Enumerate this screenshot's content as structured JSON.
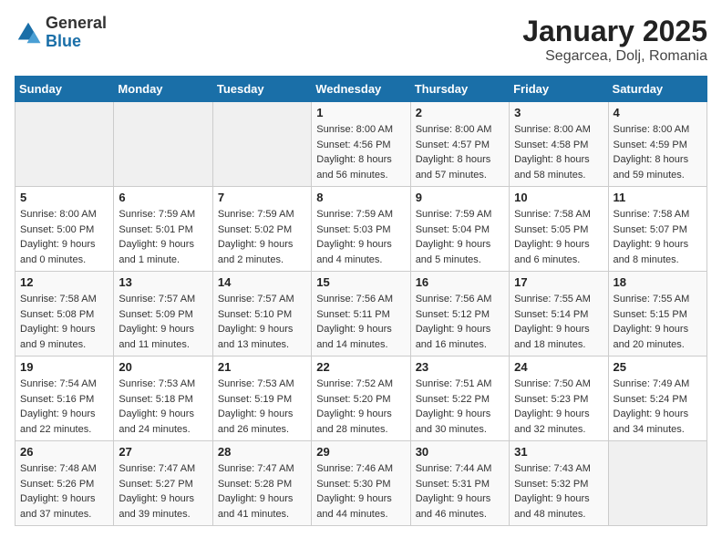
{
  "header": {
    "logo_general": "General",
    "logo_blue": "Blue",
    "title": "January 2025",
    "subtitle": "Segarcea, Dolj, Romania"
  },
  "calendar": {
    "weekdays": [
      "Sunday",
      "Monday",
      "Tuesday",
      "Wednesday",
      "Thursday",
      "Friday",
      "Saturday"
    ],
    "weeks": [
      [
        {
          "day": "",
          "info": ""
        },
        {
          "day": "",
          "info": ""
        },
        {
          "day": "",
          "info": ""
        },
        {
          "day": "1",
          "info": "Sunrise: 8:00 AM\nSunset: 4:56 PM\nDaylight: 8 hours\nand 56 minutes."
        },
        {
          "day": "2",
          "info": "Sunrise: 8:00 AM\nSunset: 4:57 PM\nDaylight: 8 hours\nand 57 minutes."
        },
        {
          "day": "3",
          "info": "Sunrise: 8:00 AM\nSunset: 4:58 PM\nDaylight: 8 hours\nand 58 minutes."
        },
        {
          "day": "4",
          "info": "Sunrise: 8:00 AM\nSunset: 4:59 PM\nDaylight: 8 hours\nand 59 minutes."
        }
      ],
      [
        {
          "day": "5",
          "info": "Sunrise: 8:00 AM\nSunset: 5:00 PM\nDaylight: 9 hours\nand 0 minutes."
        },
        {
          "day": "6",
          "info": "Sunrise: 7:59 AM\nSunset: 5:01 PM\nDaylight: 9 hours\nand 1 minute."
        },
        {
          "day": "7",
          "info": "Sunrise: 7:59 AM\nSunset: 5:02 PM\nDaylight: 9 hours\nand 2 minutes."
        },
        {
          "day": "8",
          "info": "Sunrise: 7:59 AM\nSunset: 5:03 PM\nDaylight: 9 hours\nand 4 minutes."
        },
        {
          "day": "9",
          "info": "Sunrise: 7:59 AM\nSunset: 5:04 PM\nDaylight: 9 hours\nand 5 minutes."
        },
        {
          "day": "10",
          "info": "Sunrise: 7:58 AM\nSunset: 5:05 PM\nDaylight: 9 hours\nand 6 minutes."
        },
        {
          "day": "11",
          "info": "Sunrise: 7:58 AM\nSunset: 5:07 PM\nDaylight: 9 hours\nand 8 minutes."
        }
      ],
      [
        {
          "day": "12",
          "info": "Sunrise: 7:58 AM\nSunset: 5:08 PM\nDaylight: 9 hours\nand 9 minutes."
        },
        {
          "day": "13",
          "info": "Sunrise: 7:57 AM\nSunset: 5:09 PM\nDaylight: 9 hours\nand 11 minutes."
        },
        {
          "day": "14",
          "info": "Sunrise: 7:57 AM\nSunset: 5:10 PM\nDaylight: 9 hours\nand 13 minutes."
        },
        {
          "day": "15",
          "info": "Sunrise: 7:56 AM\nSunset: 5:11 PM\nDaylight: 9 hours\nand 14 minutes."
        },
        {
          "day": "16",
          "info": "Sunrise: 7:56 AM\nSunset: 5:12 PM\nDaylight: 9 hours\nand 16 minutes."
        },
        {
          "day": "17",
          "info": "Sunrise: 7:55 AM\nSunset: 5:14 PM\nDaylight: 9 hours\nand 18 minutes."
        },
        {
          "day": "18",
          "info": "Sunrise: 7:55 AM\nSunset: 5:15 PM\nDaylight: 9 hours\nand 20 minutes."
        }
      ],
      [
        {
          "day": "19",
          "info": "Sunrise: 7:54 AM\nSunset: 5:16 PM\nDaylight: 9 hours\nand 22 minutes."
        },
        {
          "day": "20",
          "info": "Sunrise: 7:53 AM\nSunset: 5:18 PM\nDaylight: 9 hours\nand 24 minutes."
        },
        {
          "day": "21",
          "info": "Sunrise: 7:53 AM\nSunset: 5:19 PM\nDaylight: 9 hours\nand 26 minutes."
        },
        {
          "day": "22",
          "info": "Sunrise: 7:52 AM\nSunset: 5:20 PM\nDaylight: 9 hours\nand 28 minutes."
        },
        {
          "day": "23",
          "info": "Sunrise: 7:51 AM\nSunset: 5:22 PM\nDaylight: 9 hours\nand 30 minutes."
        },
        {
          "day": "24",
          "info": "Sunrise: 7:50 AM\nSunset: 5:23 PM\nDaylight: 9 hours\nand 32 minutes."
        },
        {
          "day": "25",
          "info": "Sunrise: 7:49 AM\nSunset: 5:24 PM\nDaylight: 9 hours\nand 34 minutes."
        }
      ],
      [
        {
          "day": "26",
          "info": "Sunrise: 7:48 AM\nSunset: 5:26 PM\nDaylight: 9 hours\nand 37 minutes."
        },
        {
          "day": "27",
          "info": "Sunrise: 7:47 AM\nSunset: 5:27 PM\nDaylight: 9 hours\nand 39 minutes."
        },
        {
          "day": "28",
          "info": "Sunrise: 7:47 AM\nSunset: 5:28 PM\nDaylight: 9 hours\nand 41 minutes."
        },
        {
          "day": "29",
          "info": "Sunrise: 7:46 AM\nSunset: 5:30 PM\nDaylight: 9 hours\nand 44 minutes."
        },
        {
          "day": "30",
          "info": "Sunrise: 7:44 AM\nSunset: 5:31 PM\nDaylight: 9 hours\nand 46 minutes."
        },
        {
          "day": "31",
          "info": "Sunrise: 7:43 AM\nSunset: 5:32 PM\nDaylight: 9 hours\nand 48 minutes."
        },
        {
          "day": "",
          "info": ""
        }
      ]
    ]
  }
}
